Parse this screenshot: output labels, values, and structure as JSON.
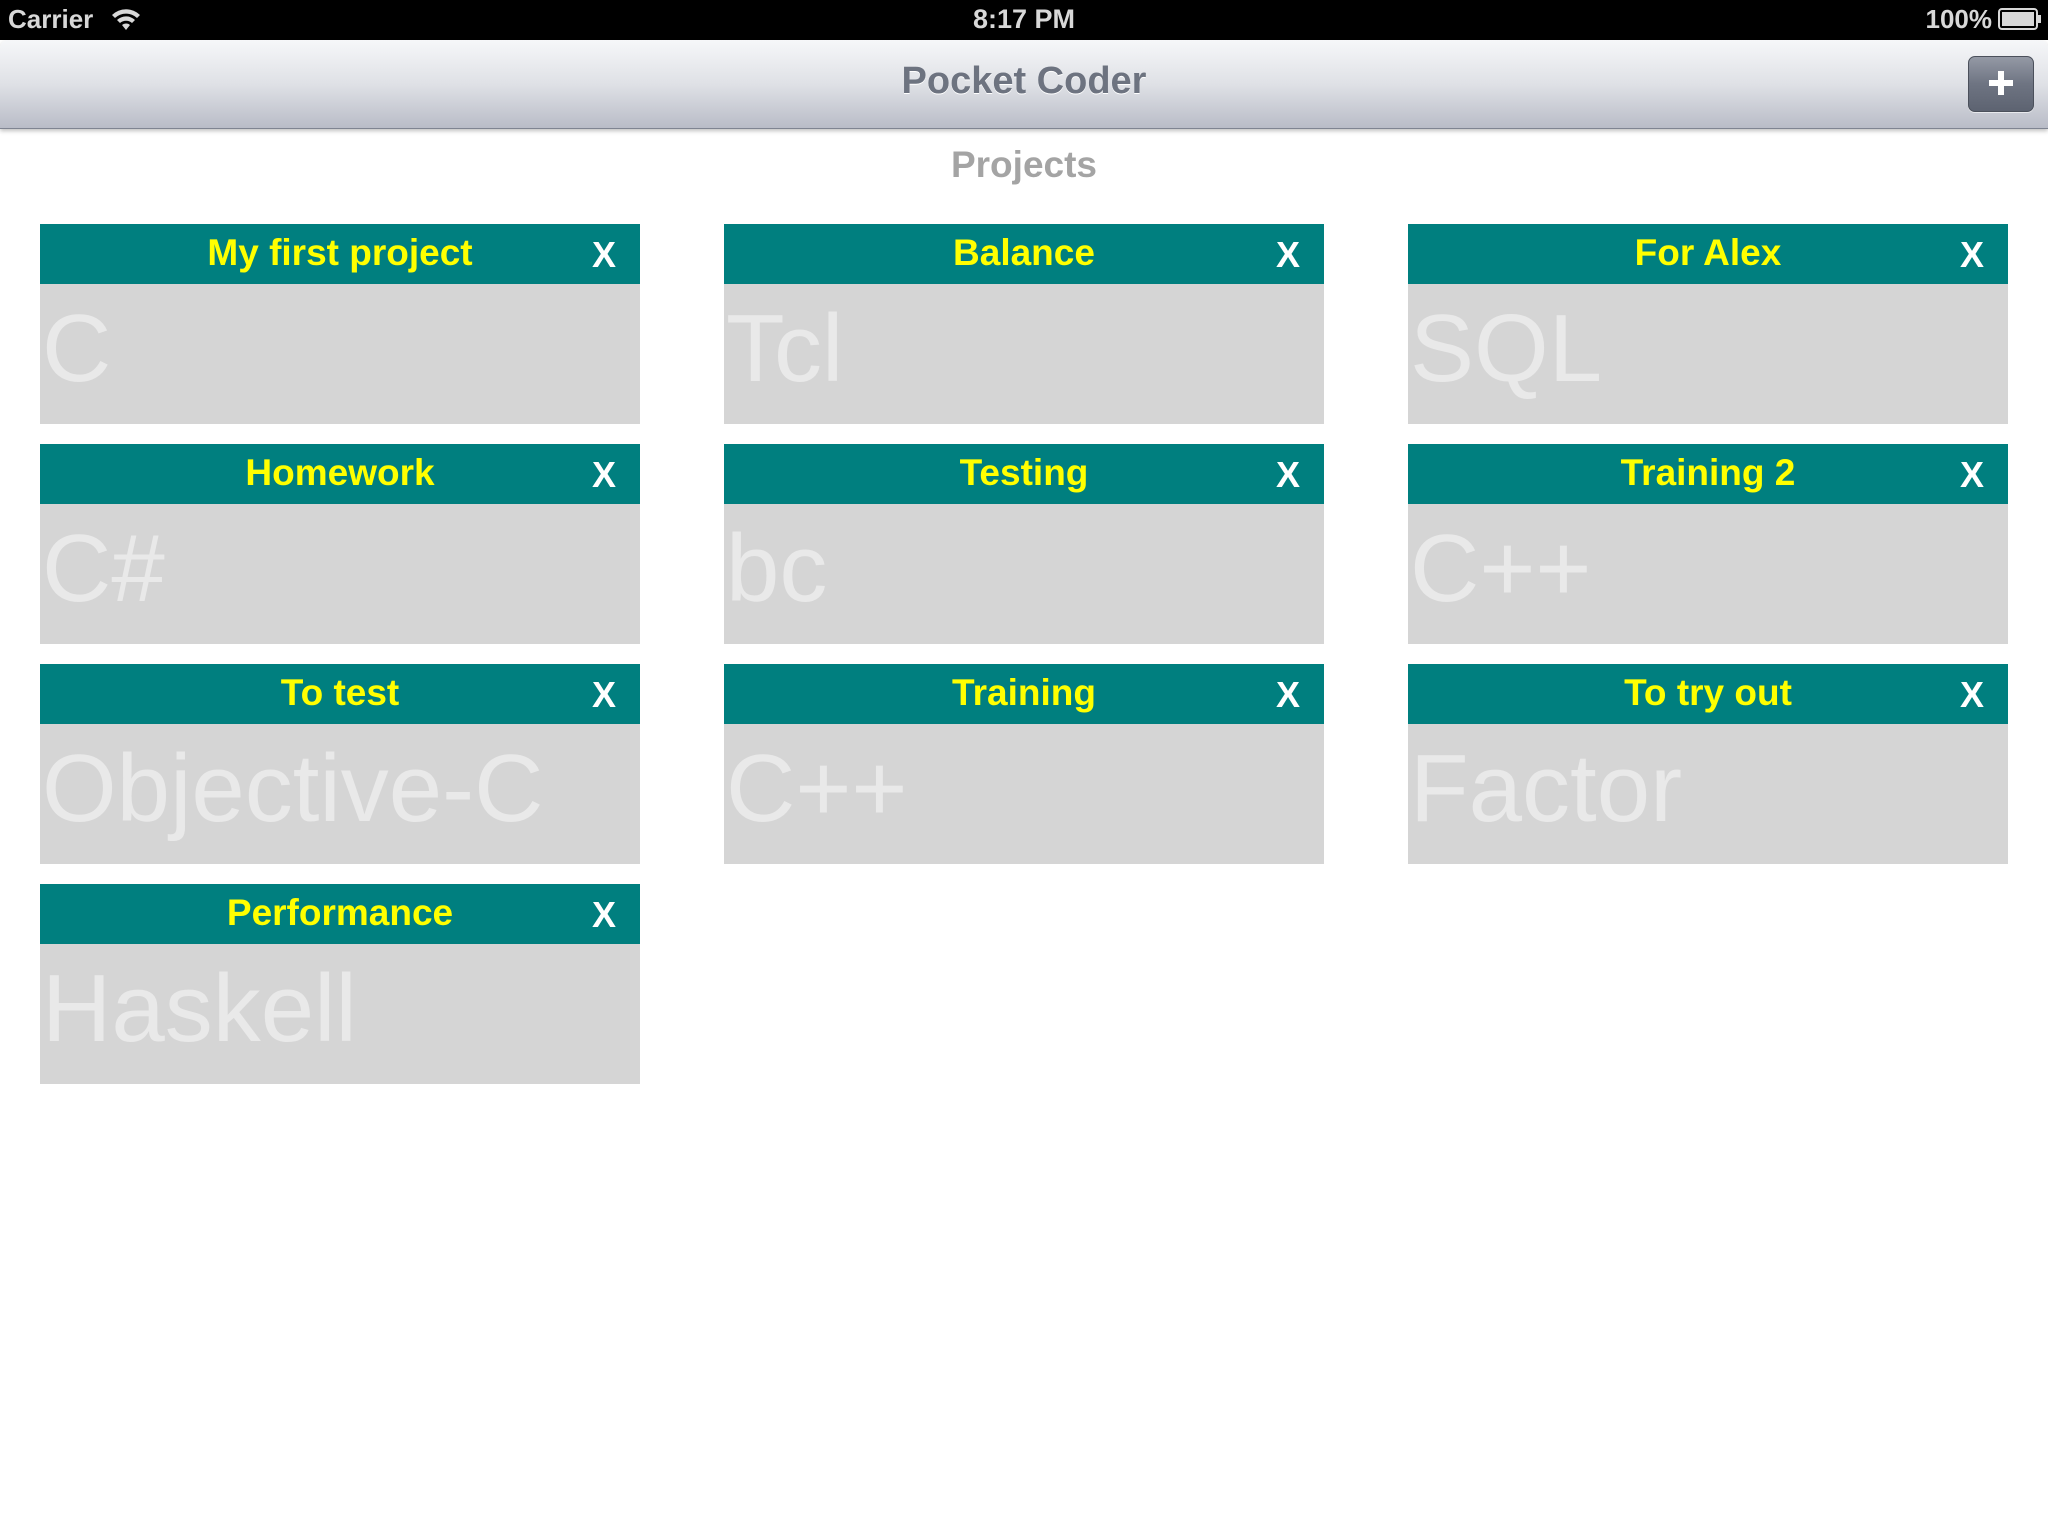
{
  "status_bar": {
    "carrier": "Carrier",
    "time": "8:17 PM",
    "battery": "100%",
    "icons": [
      "wifi-icon",
      "battery-icon"
    ]
  },
  "nav_bar": {
    "title": "Pocket Coder",
    "add_button_icon": "plus-icon"
  },
  "section_title": "Projects",
  "colors": {
    "card_header_bg": "#007f7f",
    "card_name": "#ffff00",
    "card_close": "#ffffff",
    "card_body_bg": "#d5d5d5",
    "card_lang_text": "#e9e9e9"
  },
  "projects": [
    {
      "name": "My first project",
      "language": "C",
      "close_label": "X"
    },
    {
      "name": "Balance",
      "language": "Tcl",
      "close_label": "X"
    },
    {
      "name": "For Alex",
      "language": "SQL",
      "close_label": "X"
    },
    {
      "name": "Homework",
      "language": "C#",
      "close_label": "X"
    },
    {
      "name": "Testing",
      "language": "bc",
      "close_label": "X"
    },
    {
      "name": "Training 2",
      "language": "C++",
      "close_label": "X"
    },
    {
      "name": "To test",
      "language": "Objective-C",
      "close_label": "X"
    },
    {
      "name": "Training",
      "language": "C++",
      "close_label": "X"
    },
    {
      "name": "To try out",
      "language": "Factor",
      "close_label": "X"
    },
    {
      "name": "Performance",
      "language": "Haskell",
      "close_label": "X"
    }
  ]
}
